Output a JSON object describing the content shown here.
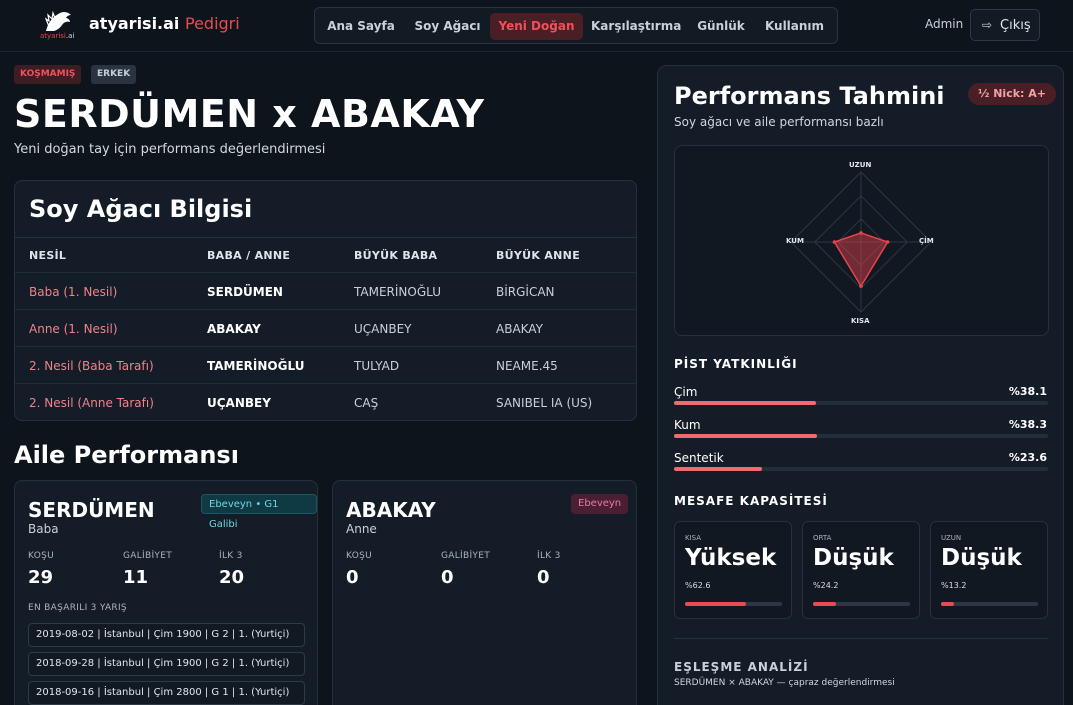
{
  "header": {
    "brand_main": "atyarisi.ai",
    "brand_accent": "Pedigri",
    "logo_text_main": "atyarisi",
    "logo_text_accent": ".ai",
    "nav": [
      "Ana Sayfa",
      "Soy Ağacı",
      "Yeni Doğan",
      "Karşılaştırma",
      "Günlük",
      "Kullanım"
    ],
    "active_nav": "Yeni Doğan",
    "user": "Admin",
    "logout": "Çıkış"
  },
  "hero": {
    "badges": [
      "KOŞMAMIŞ",
      "ERKEK"
    ],
    "title": "SERDÜMEN x ABAKAY",
    "subtitle": "Yeni doğan tay için performans değerlendirmesi"
  },
  "pedigree": {
    "title": "Soy Ağacı Bilgisi",
    "columns": [
      "NESİL",
      "BABA / ANNE",
      "BÜYÜK BABA",
      "BÜYÜK ANNE"
    ],
    "rows": [
      [
        "Baba (1. Nesil)",
        "SERDÜMEN",
        "TAMERİNOĞLU",
        "BİRGİCAN"
      ],
      [
        "Anne (1. Nesil)",
        "ABAKAY",
        "UÇANBEY",
        "ABAKAY"
      ],
      [
        "2. Nesil (Baba Tarafı)",
        "TAMERİNOĞLU",
        "TULYAD",
        "NEAME.45"
      ],
      [
        "2. Nesil (Anne Tarafı)",
        "UÇANBEY",
        "CAŞ",
        "SANIBEL IA (US)"
      ]
    ]
  },
  "family": {
    "title": "Aile Performansı",
    "parents": [
      {
        "name": "SERDÜMEN",
        "role": "Baba",
        "tag": "Ebeveyn • G1 Galibi",
        "stat_labels": [
          "KOŞU",
          "GALİBİYET",
          "İLK 3"
        ],
        "stats": [
          "29",
          "11",
          "20"
        ],
        "best_title": "EN BAŞARILI 3 YARIŞ",
        "best_races": [
          "2019-08-02 | İstanbul | Çim 1900 | G 2 | 1. (Yurtiçi)",
          "2018-09-28 | İstanbul | Çim 1900 | G 2 | 1. (Yurtiçi)",
          "2018-09-16 | İstanbul | Çim 2800 | G 1 | 1. (Yurtiçi)"
        ]
      },
      {
        "name": "ABAKAY",
        "role": "Anne",
        "tag": "Ebeveyn",
        "stat_labels": [
          "KOŞU",
          "GALİBİYET",
          "İLK 3"
        ],
        "stats": [
          "0",
          "0",
          "0"
        ]
      }
    ]
  },
  "prediction": {
    "title": "Performans Tahmini",
    "subtitle": "Soy ağacı ve aile performansı bazlı",
    "nick": "½ Nick: A+",
    "radar": {
      "labels": {
        "top": "UZUN",
        "right": "ÇİM",
        "bottom": "KISA",
        "left": "KUM"
      },
      "values": {
        "top": 0.13,
        "right": 0.38,
        "bottom": 0.63,
        "left": 0.38
      },
      "color": "#e8434b"
    },
    "pist_title": "PİST YATKINLIĞI",
    "pist": [
      {
        "label": "Çim",
        "value": "%38.1",
        "pct": 38.1
      },
      {
        "label": "Kum",
        "value": "%38.3",
        "pct": 38.3
      },
      {
        "label": "Sentetik",
        "value": "%23.6",
        "pct": 23.6
      }
    ],
    "distance_title": "MESAFE KAPASİTESİ",
    "distance": [
      {
        "label": "KISA",
        "level": "Yüksek",
        "value": "%62.6",
        "pct": 62.6
      },
      {
        "label": "ORTA",
        "level": "Düşük",
        "value": "%24.2",
        "pct": 24.2
      },
      {
        "label": "UZUN",
        "level": "Düşük",
        "value": "%13.2",
        "pct": 13.2
      }
    ],
    "match_title": "EŞLEŞME ANALİZİ",
    "match_sub": "SERDÜMEN × ABAKAY — çapraz değerlendirmesi"
  },
  "colors": {
    "accent": "#ea4a52",
    "bg": "#0e141c",
    "card": "#141c27"
  }
}
